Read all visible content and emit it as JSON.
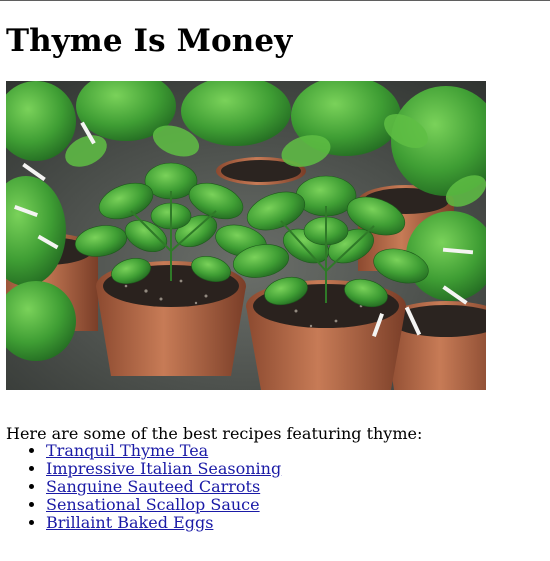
{
  "page": {
    "title": "Thyme Is Money",
    "intro": "Here are some of the best recipes featuring thyme:"
  },
  "recipes": [
    {
      "label": "Tranquil Thyme Tea"
    },
    {
      "label": "Impressive Italian Seasoning"
    },
    {
      "label": "Sanguine Sauteed Carrots"
    },
    {
      "label": "Sensational Scallop Sauce"
    },
    {
      "label": "Brillaint Baked Eggs"
    }
  ],
  "colors": {
    "link": "#1a1aa6",
    "pot": "#b86a48",
    "leaf": "#4cae3a"
  }
}
